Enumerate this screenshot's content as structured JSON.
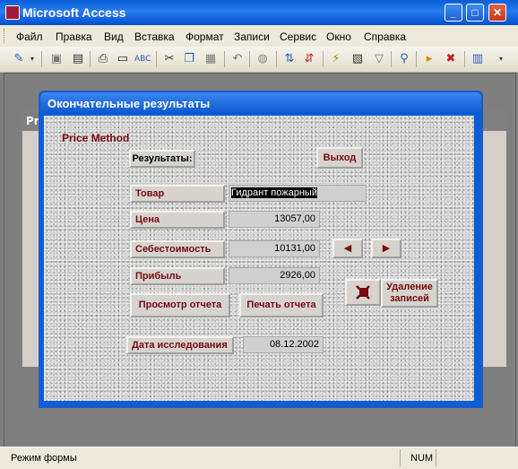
{
  "app": {
    "title": "Microsoft Access"
  },
  "window_buttons": {
    "minimize": "_",
    "maximize": "□",
    "close": "✕"
  },
  "menu": [
    "Файл",
    "Правка",
    "Вид",
    "Вставка",
    "Формат",
    "Записи",
    "Сервис",
    "Окно",
    "Справка"
  ],
  "toolbar": {
    "icons": [
      "design-view-icon",
      "save-icon",
      "print-icon",
      "print-preview-icon",
      "spelling-icon",
      "cut-icon",
      "copy-icon",
      "paste-icon",
      "undo-icon",
      "insert-hyperlink-icon",
      "sort-ascending-icon",
      "sort-descending-icon",
      "filter-by-selection-icon",
      "filter-by-form-icon",
      "apply-filter-icon",
      "find-icon",
      "new-record-icon",
      "delete-record-icon",
      "database-window-icon"
    ]
  },
  "background_form": {
    "title_prefix": "Pr"
  },
  "form": {
    "title": "Окончательные результаты",
    "price_method_label": "Price Method",
    "results_button": "Результаты:",
    "exit_button": "Выход",
    "fields": {
      "tovar": {
        "label": "Товар",
        "value": "Гидрант пожарный"
      },
      "cena": {
        "label": "Цена",
        "value": "13057,00"
      },
      "sebestoimost": {
        "label": "Себестоимость",
        "value": "10131,00"
      },
      "pribyl": {
        "label": "Прибыль",
        "value": "2926,00"
      },
      "data": {
        "label": "Дата исследования",
        "value": "08.12.2002"
      }
    },
    "view_report_button": "Просмотр отчета",
    "print_report_button": "Печать отчета",
    "delete_records_button": "Удаление записей",
    "nav_prev": "◀",
    "nav_next": "▶"
  },
  "status": {
    "mode": "Режим формы",
    "num": "NUM"
  }
}
